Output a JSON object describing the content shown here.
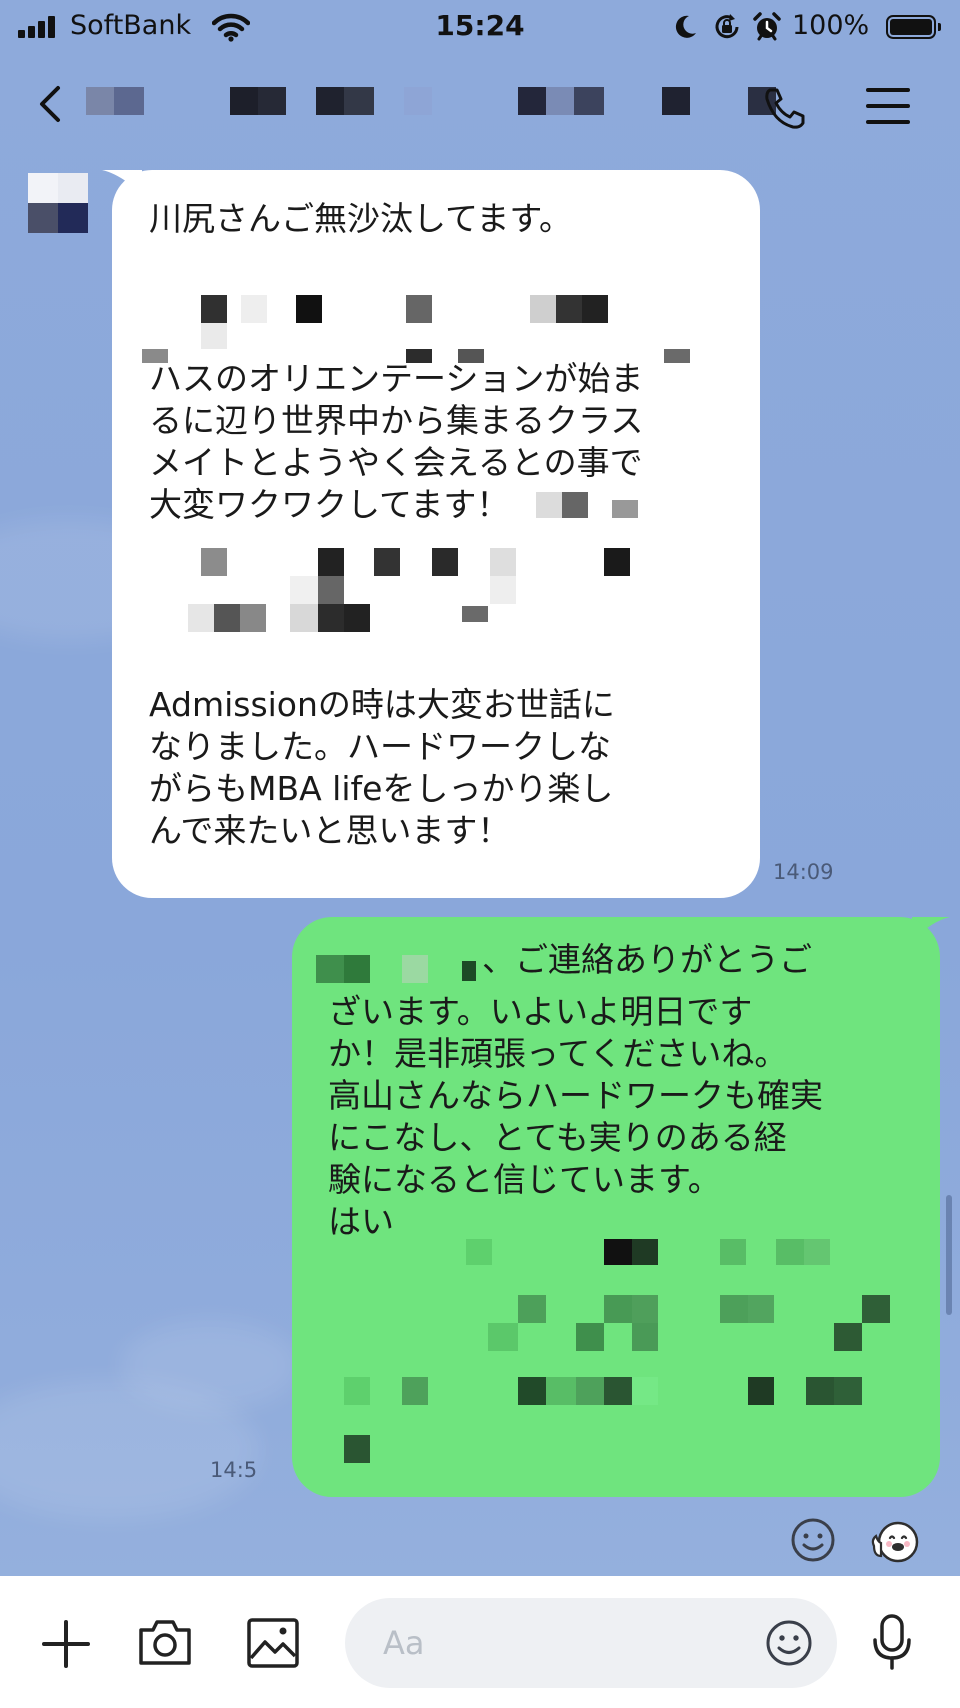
{
  "status_bar": {
    "carrier": "SoftBank",
    "time": "15:24",
    "battery": "100%"
  },
  "header": {
    "back_icon": "chevron-left-icon",
    "call_icon": "phone-icon",
    "menu_icon": "hamburger-menu-icon"
  },
  "messages": [
    {
      "direction": "incoming",
      "lines_1": "川尻さんご無沙汰してます。",
      "lines_2": "ハスのオリエンテーションが始ま\nるに辺り世界中から集まるクラス\nメイトとようやく会えるとの事で\n大変ワクワクしてます！",
      "lines_3": "Admissionの時は大変お世話に\nなりました。ハードワークしな\nがらもMBA lifeをしっかり楽し\nんで来たいと思います！",
      "time": "14:09"
    },
    {
      "direction": "outgoing",
      "lines_1": "、ご連絡ありがとうご",
      "lines_2": "ざいます。いよいよ明日です\nか！是非頑張ってくださいね。\n高山さんならハードワークも確実\nにこなし、とても実りのある経\n験になると信じています。\nはい",
      "time": "14:5"
    }
  ],
  "input_bar": {
    "placeholder": "Aa",
    "plus_icon": "plus-icon",
    "camera_icon": "camera-icon",
    "image_icon": "image-icon",
    "emoji_icon": "emoji-icon",
    "mic_icon": "microphone-icon"
  }
}
